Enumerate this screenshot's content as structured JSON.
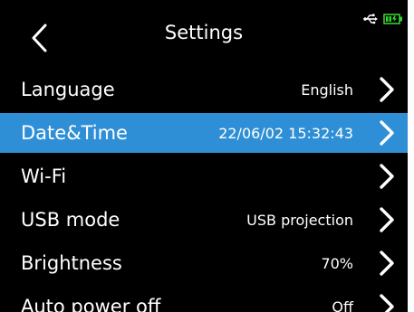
{
  "header": {
    "title": "Settings",
    "icons": [
      "back-chevron-icon",
      "usb-icon",
      "battery-charging-icon"
    ],
    "battery_color": "#38d12e"
  },
  "theme": {
    "background": "#000000",
    "selected_row": "#2f8fd6",
    "text": "#ffffff"
  },
  "settings": {
    "items": [
      {
        "label": "Language",
        "value": "English",
        "selected": false
      },
      {
        "label": "Date&Time",
        "value": "22/06/02 15:32:43",
        "selected": true
      },
      {
        "label": "Wi-Fi",
        "value": "",
        "selected": false
      },
      {
        "label": "USB mode",
        "value": "USB projection",
        "selected": false
      },
      {
        "label": "Brightness",
        "value": "70%",
        "selected": false
      },
      {
        "label": "Auto power off",
        "value": "Off",
        "selected": false
      }
    ]
  }
}
